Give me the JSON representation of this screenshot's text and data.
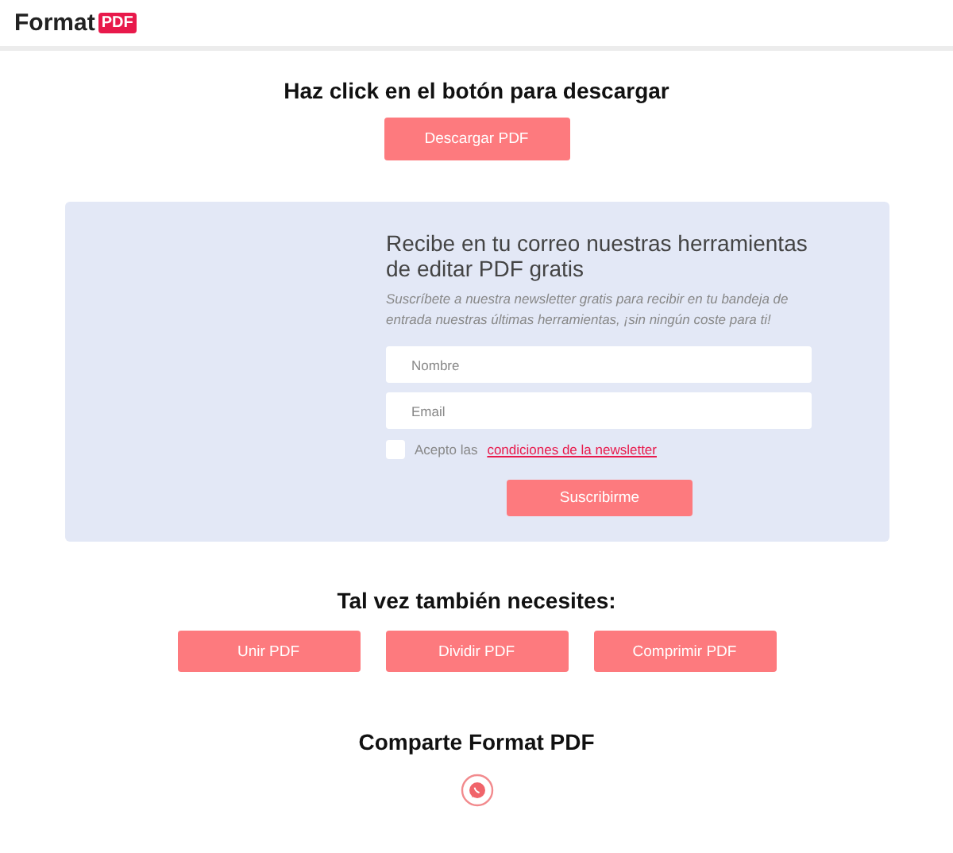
{
  "header": {
    "logo_text": "Format",
    "logo_badge": "PDF"
  },
  "download": {
    "title": "Haz click en el botón para descargar",
    "button": "Descargar PDF"
  },
  "newsletter": {
    "title": "Recibe en tu correo nuestras herramientas de editar PDF gratis",
    "subtitle": "Suscríbete a nuestra newsletter gratis para recibir en tu bandeja de entrada nuestras últimas herramientas, ¡sin ningún coste para ti!",
    "fields": [
      {
        "placeholder": "Nombre"
      },
      {
        "placeholder": "Email"
      }
    ],
    "consent": {
      "checked": false,
      "text": "Acepto las",
      "link": "condiciones de la newsletter"
    },
    "button": "Suscribirme"
  },
  "related": {
    "title": "Tal vez también necesites:",
    "buttons": [
      "Unir PDF",
      "Dividir PDF",
      "Comprimir PDF"
    ]
  },
  "share": {
    "title": "Comparte Format PDF"
  }
}
